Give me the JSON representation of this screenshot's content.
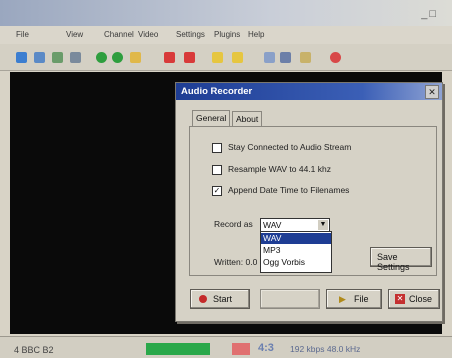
{
  "app": {
    "title": "",
    "menu": [
      "File",
      "View",
      "Channel",
      "Video",
      "Settings",
      "Plugins",
      "Help"
    ]
  },
  "status": {
    "channel": "4 BBC B2",
    "aspect": "4:3",
    "bitrate": "192 kbps 48.0 kHz"
  },
  "dialog": {
    "title": "Audio Recorder",
    "tabs": [
      "General",
      "About"
    ],
    "options": [
      {
        "label": "Stay Connected to Audio Stream",
        "checked": false
      },
      {
        "label": "Resample WAV to 44.1 khz",
        "checked": false
      },
      {
        "label": "Append Date Time to Filenames",
        "checked": true
      }
    ],
    "record_as_label": "Record as",
    "record_as_value": "WAV",
    "format_options": [
      "WAV",
      "MP3",
      "Ogg Vorbis"
    ],
    "written_label": "Written: 0.0",
    "buttons": {
      "save_settings": "Save Settings",
      "start": "Start",
      "stop": "",
      "file": "File",
      "close": "Close"
    }
  },
  "colors": {
    "dialog_title_bar": "#1e3d94",
    "selected_option": "#1e3d94",
    "status_meter": "#2aa84a"
  }
}
